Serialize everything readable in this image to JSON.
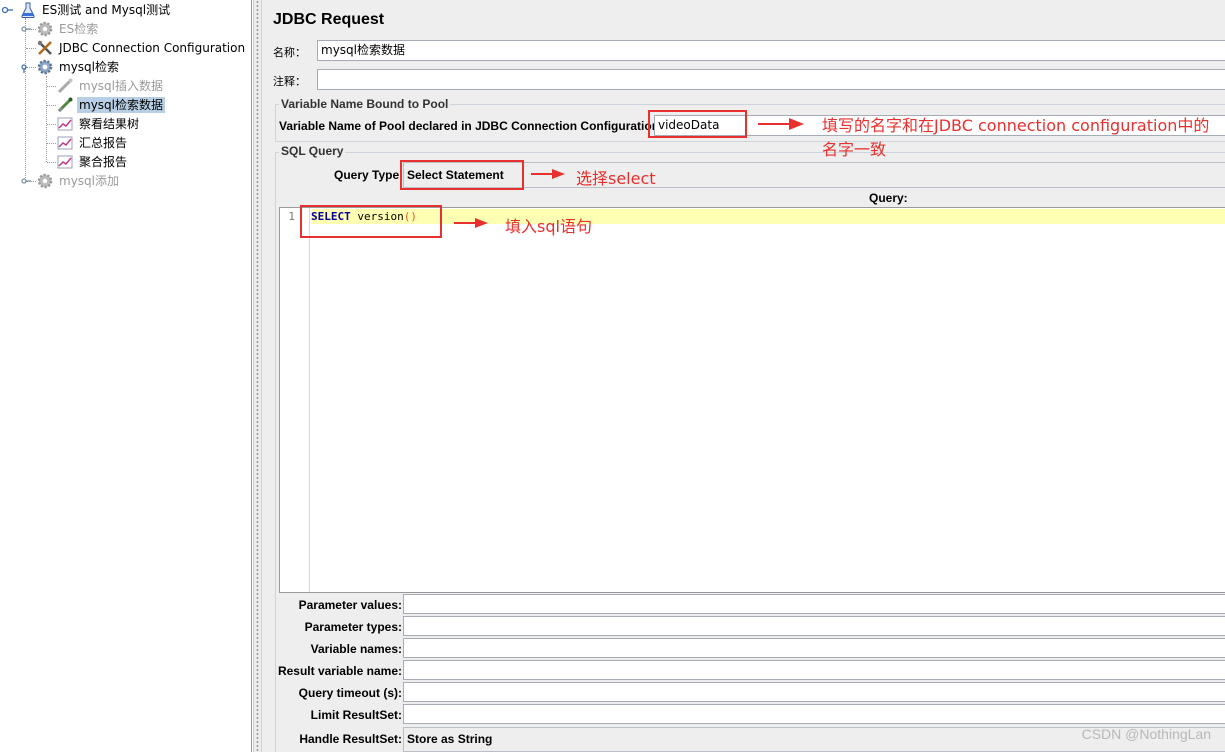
{
  "tree": {
    "root": {
      "label": "ES测试 and Mysql测试"
    },
    "items": [
      {
        "label": "ES检索"
      },
      {
        "label": "JDBC Connection Configuration"
      },
      {
        "label": "mysql检索"
      },
      {
        "label": "mysql插入数据"
      },
      {
        "label": "mysql检索数据"
      },
      {
        "label": "察看结果树"
      },
      {
        "label": "汇总报告"
      },
      {
        "label": "聚合报告"
      },
      {
        "label": "mysql添加"
      }
    ]
  },
  "panel": {
    "title": "JDBC Request",
    "name_label": "名称：",
    "name_value": "mysql检索数据",
    "comment_label": "注释：",
    "comment_value": "",
    "pool_group_title": "Variable Name Bound to Pool",
    "pool_label": "Variable Name of Pool declared in JDBC Connection Configuration:",
    "pool_value": "videoData",
    "sql_group_title": "SQL Query",
    "query_type_label": "Query Type:",
    "query_type_value": "Select Statement",
    "query_header": "Query:",
    "editor": {
      "line_number": "1",
      "keyword": "SELECT",
      "code": " version",
      "parens": "()"
    },
    "params": [
      {
        "label": "Parameter values:",
        "value": ""
      },
      {
        "label": "Parameter types:",
        "value": ""
      },
      {
        "label": "Variable names:",
        "value": ""
      },
      {
        "label": "Result variable name:",
        "value": ""
      },
      {
        "label": "Query timeout (s):",
        "value": ""
      },
      {
        "label": "Limit ResultSet:",
        "value": ""
      },
      {
        "label": "Handle ResultSet:",
        "value": "Store as String"
      }
    ]
  },
  "annotations": {
    "pool_note_line1": "填写的名字和在JDBC connection configuration中的",
    "pool_note_line2": "名字一致",
    "query_type_note": "选择select",
    "sql_note": "填入sql语句",
    "color": "#e8302e"
  },
  "watermark": "CSDN @NothingLan",
  "colors": {
    "selection": "#b8cfe5",
    "current_line": "#ffffb4",
    "keyword": "#0000a0",
    "panel_bg": "#eeeeee"
  }
}
